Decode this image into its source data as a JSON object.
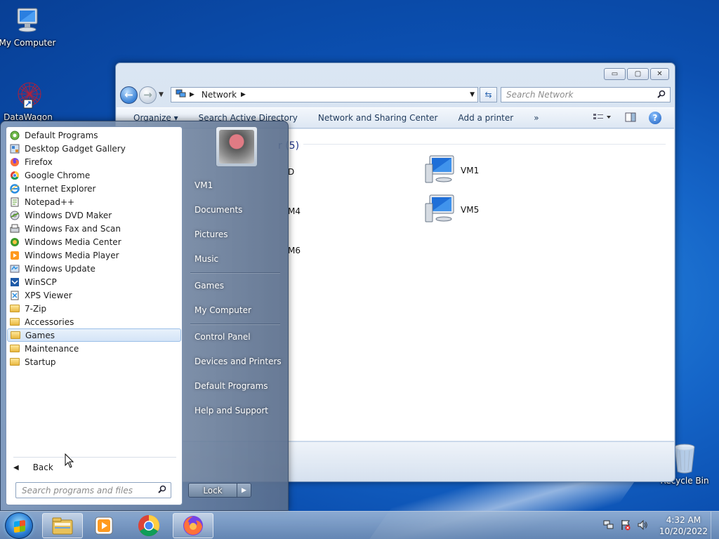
{
  "desktop": {
    "icons": [
      {
        "label": "My Computer"
      },
      {
        "label": "DataWagon"
      },
      {
        "label": "Recycle Bin"
      }
    ]
  },
  "explorer": {
    "caption_buttons": {
      "minimize": "▭",
      "maximize": "▢",
      "close": "✕"
    },
    "address": {
      "location": "Network"
    },
    "search_placeholder": "Search Network",
    "commands": [
      "Organize ▾",
      "Search Active Directory",
      "Network and Sharing Center",
      "Add a printer",
      "»"
    ],
    "group_header": "r (5)",
    "network_items": [
      {
        "label": "D"
      },
      {
        "label": "VM1"
      },
      {
        "label": "M4"
      },
      {
        "label": "VM5"
      },
      {
        "label": "M6"
      }
    ]
  },
  "start_menu": {
    "programs": [
      {
        "label": "Default Programs",
        "icon": "default-programs-icon"
      },
      {
        "label": "Desktop Gadget Gallery",
        "icon": "gadget-icon"
      },
      {
        "label": "Firefox",
        "icon": "firefox-icon"
      },
      {
        "label": "Google Chrome",
        "icon": "chrome-icon"
      },
      {
        "label": "Internet Explorer",
        "icon": "ie-icon"
      },
      {
        "label": "Notepad++",
        "icon": "notepad-icon"
      },
      {
        "label": "Windows DVD Maker",
        "icon": "dvd-icon"
      },
      {
        "label": "Windows Fax and Scan",
        "icon": "fax-icon"
      },
      {
        "label": "Windows Media Center",
        "icon": "media-center-icon"
      },
      {
        "label": "Windows Media Player",
        "icon": "media-player-icon"
      },
      {
        "label": "Windows Update",
        "icon": "update-icon"
      },
      {
        "label": "WinSCP",
        "icon": "winscp-icon"
      },
      {
        "label": "XPS Viewer",
        "icon": "xps-icon"
      },
      {
        "label": "7-Zip",
        "icon": "folder-icon"
      },
      {
        "label": "Accessories",
        "icon": "folder-icon"
      },
      {
        "label": "Games",
        "icon": "folder-icon",
        "selected": true
      },
      {
        "label": "Maintenance",
        "icon": "folder-icon"
      },
      {
        "label": "Startup",
        "icon": "folder-icon"
      }
    ],
    "back_label": "Back",
    "search_placeholder": "Search programs and files",
    "right_items": {
      "user": "VM1",
      "documents": "Documents",
      "pictures": "Pictures",
      "music": "Music",
      "games": "Games",
      "computer": "My Computer",
      "control_panel": "Control Panel",
      "devices": "Devices and Printers",
      "default_programs": "Default Programs",
      "help": "Help and Support"
    },
    "lock_label": "Lock"
  },
  "taskbar": {
    "clock": {
      "time": "4:32 AM",
      "date": "10/20/2022"
    }
  }
}
